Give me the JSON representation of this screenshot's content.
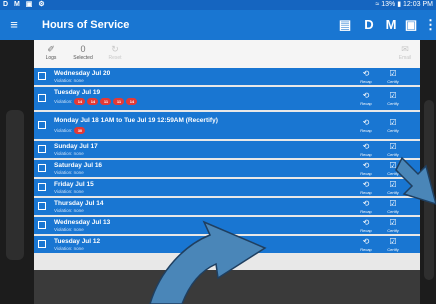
{
  "status_bar": {
    "left_icons": "D M ▣ ⚙",
    "right_text": "≈ 13% ▮ 12:03 PM"
  },
  "app_bar": {
    "menu_icon": "≡",
    "title": "Hours of Service",
    "icon_list": "▤",
    "icon_d": "D",
    "icon_m": "M",
    "icon_sync": "▣",
    "icon_more": "⋮"
  },
  "toolbar": {
    "logs_label": "Logs",
    "logs_icon": "✐",
    "selected_count": "0",
    "selected_label": "Selected",
    "reset_label": "Reset",
    "reset_icon": "↻",
    "email_label": "Email",
    "email_icon": "✉"
  },
  "actions": {
    "recap_label": "Recap",
    "recap_icon": "⟲",
    "certify_label": "Certify",
    "certify_icon": "☑"
  },
  "logs": [
    {
      "day": "Wednesday Jul 20",
      "violation_text": "Violation: none"
    },
    {
      "day": "Tuesday Jul 19",
      "violation_prefix": "Violation:",
      "badges": [
        "14",
        "14",
        "11",
        "11",
        "14"
      ]
    },
    {
      "day": "Monday Jul 18 1AM to Tue Jul 19 12:59AM (Recertify)",
      "violation_prefix": "Violation:",
      "badges": [
        "30"
      ]
    },
    {
      "day": "Sunday Jul 17",
      "violation_text": "Violation: none"
    },
    {
      "day": "Saturday Jul 16",
      "violation_text": "Violation: none"
    },
    {
      "day": "Friday Jul 15",
      "violation_text": "Violation: none"
    },
    {
      "day": "Thursday Jul 14",
      "violation_text": "Violation: none"
    },
    {
      "day": "Wednesday Jul 13",
      "violation_text": "Violation: none"
    },
    {
      "day": "Tuesday Jul 12",
      "violation_text": "Violation: none"
    }
  ],
  "colors": {
    "primary": "#1976d2",
    "status_bar": "#1565c0",
    "badge": "#e53935",
    "arrow": "#4a86b8"
  }
}
